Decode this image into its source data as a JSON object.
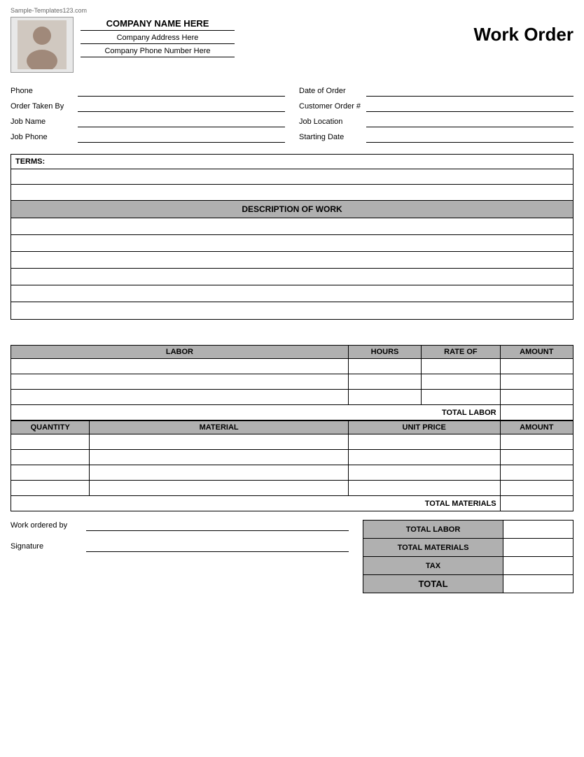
{
  "watermark": "Sample-Templates123.com",
  "header": {
    "company_name": "COMPANY NAME HERE",
    "company_address": "Company Address Here",
    "company_phone": "Company Phone Number Here",
    "title": "Work Order"
  },
  "form": {
    "left": [
      {
        "label": "Phone",
        "value": ""
      },
      {
        "label": "Order Taken By",
        "value": ""
      },
      {
        "label": "Job Name",
        "value": ""
      },
      {
        "label": "Job Phone",
        "value": ""
      }
    ],
    "right": [
      {
        "label": "Date of Order",
        "value": ""
      },
      {
        "label": "Customer Order #",
        "value": ""
      },
      {
        "label": "Job Location",
        "value": ""
      },
      {
        "label": "Starting Date",
        "value": ""
      }
    ]
  },
  "terms": {
    "label": "TERMS:",
    "rows": [
      "",
      ""
    ]
  },
  "description": {
    "header": "DESCRIPTION OF WORK",
    "rows": [
      "",
      "",
      "",
      "",
      "",
      ""
    ]
  },
  "labor": {
    "columns": [
      "LABOR",
      "HOURS",
      "RATE OF",
      "AMOUNT"
    ],
    "rows": [
      {
        "labor": "",
        "hours": "",
        "rate": "",
        "amount": ""
      },
      {
        "labor": "",
        "hours": "",
        "rate": "",
        "amount": ""
      },
      {
        "labor": "",
        "hours": "",
        "rate": "",
        "amount": ""
      }
    ],
    "total_label": "TOTAL LABOR"
  },
  "materials": {
    "columns": [
      "QUANTITY",
      "MATERIAL",
      "UNIT PRICE",
      "AMOUNT"
    ],
    "rows": [
      {
        "qty": "",
        "material": "",
        "unit_price": "",
        "amount": ""
      },
      {
        "qty": "",
        "material": "",
        "unit_price": "",
        "amount": ""
      },
      {
        "qty": "",
        "material": "",
        "unit_price": "",
        "amount": ""
      },
      {
        "qty": "",
        "material": "",
        "unit_price": "",
        "amount": ""
      }
    ],
    "total_label": "TOTAL MATERIALS"
  },
  "summary": {
    "work_ordered_by_label": "Work ordered by",
    "signature_label": "Signature",
    "totals": [
      {
        "label": "TOTAL LABOR",
        "value": ""
      },
      {
        "label": "TOTAL MATERIALS",
        "value": ""
      },
      {
        "label": "TAX",
        "value": ""
      },
      {
        "label": "TOTAL",
        "value": ""
      }
    ]
  }
}
